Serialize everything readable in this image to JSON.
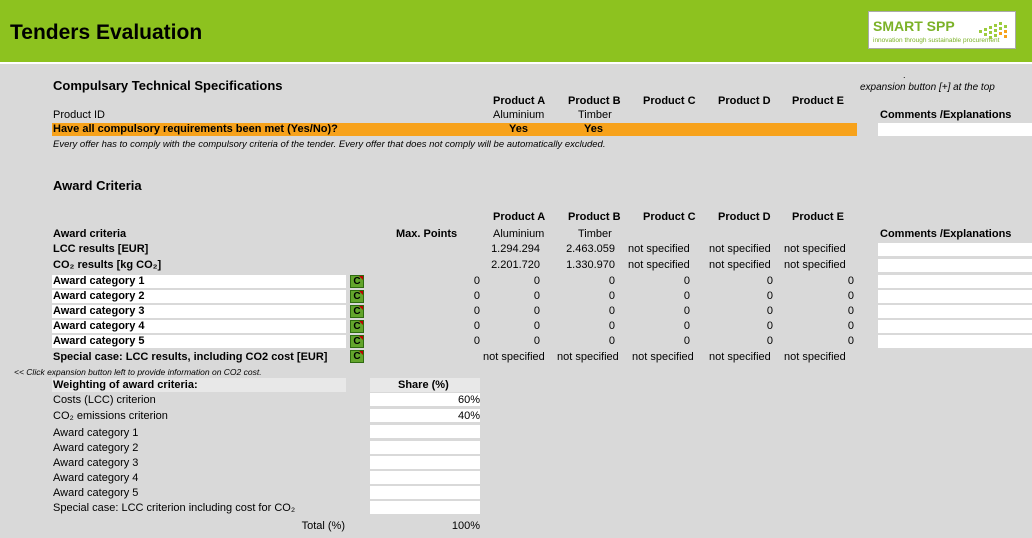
{
  "header": {
    "title": "Tenders Evaluation",
    "logo_main": "SMART SPP",
    "logo_tagline": "innovation through sustainable procurement"
  },
  "side_note": {
    "dot": ".",
    "text": "expansion button [+] at the top"
  },
  "compulsory": {
    "title": "Compulsary Technical Specifications",
    "products": [
      "Product A",
      "Product B",
      "Product C",
      "Product D",
      "Product E"
    ],
    "product_id_label": "Product ID",
    "product_ids": [
      "Aluminium",
      "Timber",
      "",
      "",
      ""
    ],
    "question": "Have all compulsory requirements been met (Yes/No)?",
    "answers": [
      "Yes",
      "Yes",
      "",
      "",
      ""
    ],
    "note": "Every offer has to comply with the compulsory criteria of the tender. Every offer that does not comply will be automatically excluded.",
    "comments_header": "Comments /Explanations"
  },
  "award": {
    "title": "Award Criteria",
    "products": [
      "Product A",
      "Product B",
      "Product C",
      "Product D",
      "Product E"
    ],
    "criteria_header": "Award criteria",
    "max_points_header": "Max. Points",
    "product_ids": [
      "Aluminium",
      "Timber",
      "",
      "",
      ""
    ],
    "comments_header": "Comments /Explanations",
    "lcc": {
      "label": "LCC results [EUR]",
      "values": [
        "1.294.294",
        "2.463.059",
        "not specified",
        "not specified",
        "not specified"
      ]
    },
    "co2": {
      "label": "CO₂ results [kg CO₂]",
      "values": [
        "2.201.720",
        "1.330.970",
        "not specified",
        "not specified",
        "not specified"
      ]
    },
    "button_label": "C",
    "categories": [
      {
        "label": "Award category 1",
        "max": "0",
        "values": [
          "0",
          "0",
          "0",
          "0",
          "0"
        ]
      },
      {
        "label": "Award category 2",
        "max": "0",
        "values": [
          "0",
          "0",
          "0",
          "0",
          "0"
        ]
      },
      {
        "label": "Award category 3",
        "max": "0",
        "values": [
          "0",
          "0",
          "0",
          "0",
          "0"
        ]
      },
      {
        "label": "Award category 4",
        "max": "0",
        "values": [
          "0",
          "0",
          "0",
          "0",
          "0"
        ]
      },
      {
        "label": "Award category 5",
        "max": "0",
        "values": [
          "0",
          "0",
          "0",
          "0",
          "0"
        ]
      }
    ],
    "special": {
      "label": "Special case: LCC results, including CO2 cost [EUR]",
      "values": [
        "not specified",
        "not specified",
        "not specified",
        "not specified",
        "not specified"
      ]
    },
    "click_note": "<< Click expansion button left to provide information on CO2 cost."
  },
  "weighting": {
    "title": "Weighting of award criteria:",
    "share_header": "Share (%)",
    "rows": [
      {
        "label": "Costs (LCC) criterion",
        "value": "60%"
      },
      {
        "label": "CO₂ emissions criterion",
        "value": "40%"
      },
      {
        "label": "Award category 1",
        "value": ""
      },
      {
        "label": "Award category 2",
        "value": ""
      },
      {
        "label": "Award category 3",
        "value": ""
      },
      {
        "label": "Award category 4",
        "value": ""
      },
      {
        "label": "Award category 5",
        "value": ""
      },
      {
        "label": "Special case: LCC criterion including cost for CO₂",
        "value": ""
      }
    ],
    "total_label": "Total (%)",
    "total_value": "100%"
  },
  "colors": {
    "header_green": "#8dc21f",
    "yes_orange": "#f7a21b",
    "button_green": "#63a52c",
    "background": "#d9d9d9"
  }
}
